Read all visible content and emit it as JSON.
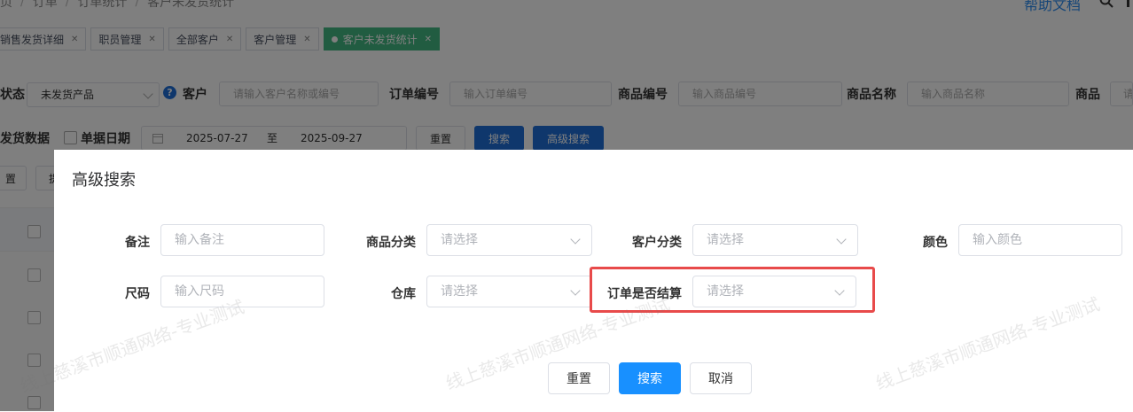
{
  "breadcrumb": {
    "items": [
      "页",
      "订单",
      "订单统计",
      "客户未发货统计"
    ]
  },
  "help": {
    "label": "帮助文档"
  },
  "tabs": [
    {
      "label": "销售发货详细"
    },
    {
      "label": "职员管理"
    },
    {
      "label": "全部客户"
    },
    {
      "label": "客户管理"
    },
    {
      "label": "客户未发货统计",
      "active": true
    }
  ],
  "filter": {
    "status_label": "状态",
    "status_value": "未发货产品",
    "customer_label": "客户",
    "customer_placeholder": "请输入客户名称或编号",
    "order_no_label": "订单编号",
    "order_no_placeholder": "输入订单编号",
    "product_no_label": "商品编号",
    "product_no_placeholder": "输入商品编号",
    "product_name_label": "商品名称",
    "product_name_placeholder": "输入商品名称",
    "product_label": "商品",
    "product_placeholder": "请",
    "shipped_label": "发货数据",
    "doc_date_label": "单据日期",
    "date_from": "2025-07-27",
    "date_to_sep": "至",
    "date_to": "2025-09-27",
    "reset": "重置",
    "search": "搜索",
    "advanced": "高级搜索"
  },
  "toolbar": {
    "reset_partial": "置",
    "btn2_partial": "提"
  },
  "dialog": {
    "title": "高级搜索",
    "remark_label": "备注",
    "remark_placeholder": "输入备注",
    "category_label": "商品分类",
    "category_placeholder": "请选择",
    "customer_cat_label": "客户分类",
    "customer_cat_placeholder": "请选择",
    "color_label": "颜色",
    "color_placeholder": "输入颜色",
    "size_label": "尺码",
    "size_placeholder": "输入尺码",
    "warehouse_label": "仓库",
    "warehouse_placeholder": "请选择",
    "settled_label": "订单是否结算",
    "settled_placeholder": "请选择",
    "reset": "重置",
    "search": "搜索",
    "cancel": "取消"
  },
  "watermark": {
    "text1": "线上慈溪市顺通网络-专业测试",
    "text2": "线上慈溪市顺通网络-专业测试",
    "text3": "线上慈溪市顺通网络-专业测试"
  },
  "colors": {
    "primary": "#1e6fd9",
    "dialog_primary": "#1890ff",
    "tab_active": "#42b983",
    "highlight": "#e84a4a"
  }
}
